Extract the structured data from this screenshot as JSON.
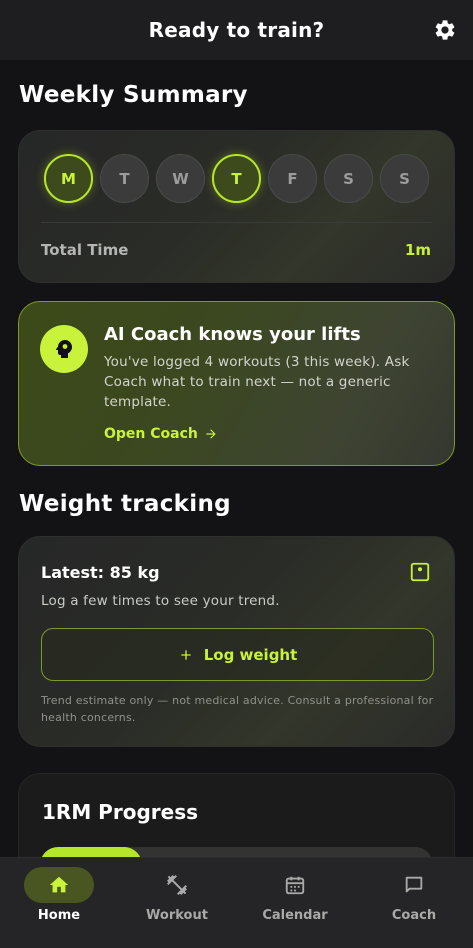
{
  "header": {
    "title": "Ready to train?",
    "settings_icon": "gear-icon"
  },
  "weekly_summary": {
    "title": "Weekly Summary",
    "days": [
      {
        "label": "M",
        "active": true
      },
      {
        "label": "T",
        "active": false
      },
      {
        "label": "W",
        "active": false
      },
      {
        "label": "T",
        "active": true
      },
      {
        "label": "F",
        "active": false
      },
      {
        "label": "S",
        "active": false
      },
      {
        "label": "S",
        "active": false
      }
    ],
    "total_label": "Total Time",
    "total_value": "1m"
  },
  "coach_card": {
    "title": "AI Coach knows your lifts",
    "body": "You've logged 4 workouts (3 this week). Ask Coach what to train next — not a generic template.",
    "link_label": "Open Coach",
    "link_icon": "arrow-right-icon",
    "avatar_icon": "head-brain-icon"
  },
  "weight_tracking": {
    "title": "Weight tracking",
    "latest": "Latest: 85 kg",
    "hint": "Log a few times to see your trend.",
    "button_label": "Log weight",
    "button_icon": "plus-icon",
    "scale_icon": "scale-icon",
    "disclaimer": "Trend estimate only — not medical advice. Consult a professional for health concerns."
  },
  "rm_progress": {
    "title": "1RM Progress"
  },
  "bottom_nav": {
    "items": [
      {
        "label": "Home",
        "icon": "home-icon",
        "active": true
      },
      {
        "label": "Workout",
        "icon": "dumbbell-icon",
        "active": false
      },
      {
        "label": "Calendar",
        "icon": "calendar-icon",
        "active": false
      },
      {
        "label": "Coach",
        "icon": "chat-icon",
        "active": false
      }
    ]
  },
  "colors": {
    "accent": "#c9f23a",
    "background": "#131315",
    "card": "#2a2b29"
  }
}
